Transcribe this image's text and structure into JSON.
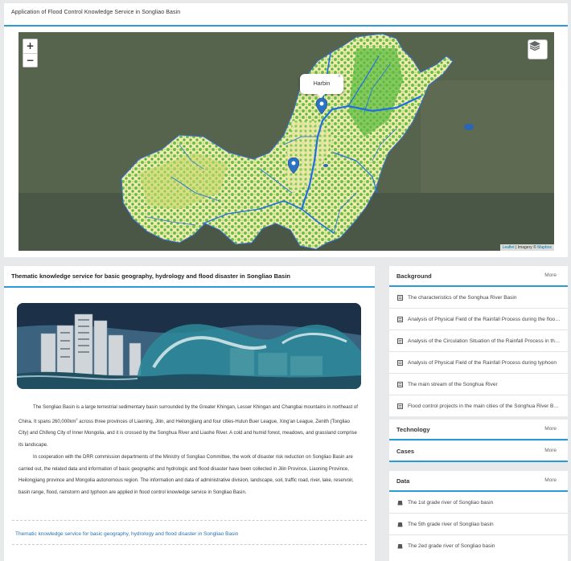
{
  "top": {
    "title": "Application of Flood Control Knowledge Service in Songliao Basin"
  },
  "map": {
    "zoom_in": "+",
    "zoom_out": "−",
    "popup_label": "Harbin",
    "popup_close": "×",
    "attribution_leaflet": "Leaflet",
    "attribution_sep": " | Imagery © ",
    "attribution_mapbox": "Mapbox"
  },
  "main": {
    "title": "Thematic knowledge service for basic geography, hydrology and flood disaster in Songliao Basin",
    "para1_a": "The Songliao Basin is a large terrestrial sedimentary basin surrounded by the Greater Khingan, Lesser Khingan and Changbai mountains in northeast of China. It spans 260,000km",
    "para1_sup": "2",
    "para1_b": " across three provinces of Liaoning, Jilin, and Heilongjiang and four cities-Hulun Buer League, Xing'an League, Zenith (Tongliao City) and Chifeng City of Inner Mongolia, and it is crossed by the Songhua River and Liaohe River. A cold and humid forest, meadows, and grassland comprise its landscape.",
    "para2": "In cooperation with the DRR commission departments of the Ministry of Songliao Committee, the work of disaster risk reduction on Songliao Basin are carried out, the related data and information of basic geographic and hydrologic and flood disaster have been collected in Jilin Province, Liaoning Province, Heilongjiang province and Mongolia autonomous region. The information and data of administrative division, landscape, soil, traffic road, river, lake, reservoir, basin range, flood, rainstorm and typhoon are applied in flood control knowledge service in Songliao Basin.",
    "link": "Thematic knowledge service for basic geography, hydrology and flood disaster in Songliao Basin"
  },
  "background": {
    "title": "Background",
    "more": "More",
    "items": [
      "The characteristics of the Songhua River Basin",
      "Analysis of Physical Field of the Rainfall Process during the flood season",
      "Analysis of the Circulation Situation of the Rainfall Process in the basin",
      "Analysis of Physical Field of the Rainfall Process during typhoon",
      "The main stream of the Songhua River",
      "Flood control projects in the main cities of the Songhua River Basin"
    ]
  },
  "technology": {
    "title": "Technology",
    "more": "More"
  },
  "cases": {
    "title": "Cases",
    "more": "More"
  },
  "data": {
    "title": "Data",
    "more": "More",
    "items": [
      "The 1st grade river of Songliao basin",
      "The 5th grade river of Songliao basin",
      "The 2ed grade river of Songliao basin"
    ]
  },
  "colors": {
    "accent": "#2a9bd6",
    "river": "#1f6fe0",
    "vegetation": "#6cc04a",
    "farmland": "#f0ecb0",
    "pin": "#2a73c4"
  }
}
